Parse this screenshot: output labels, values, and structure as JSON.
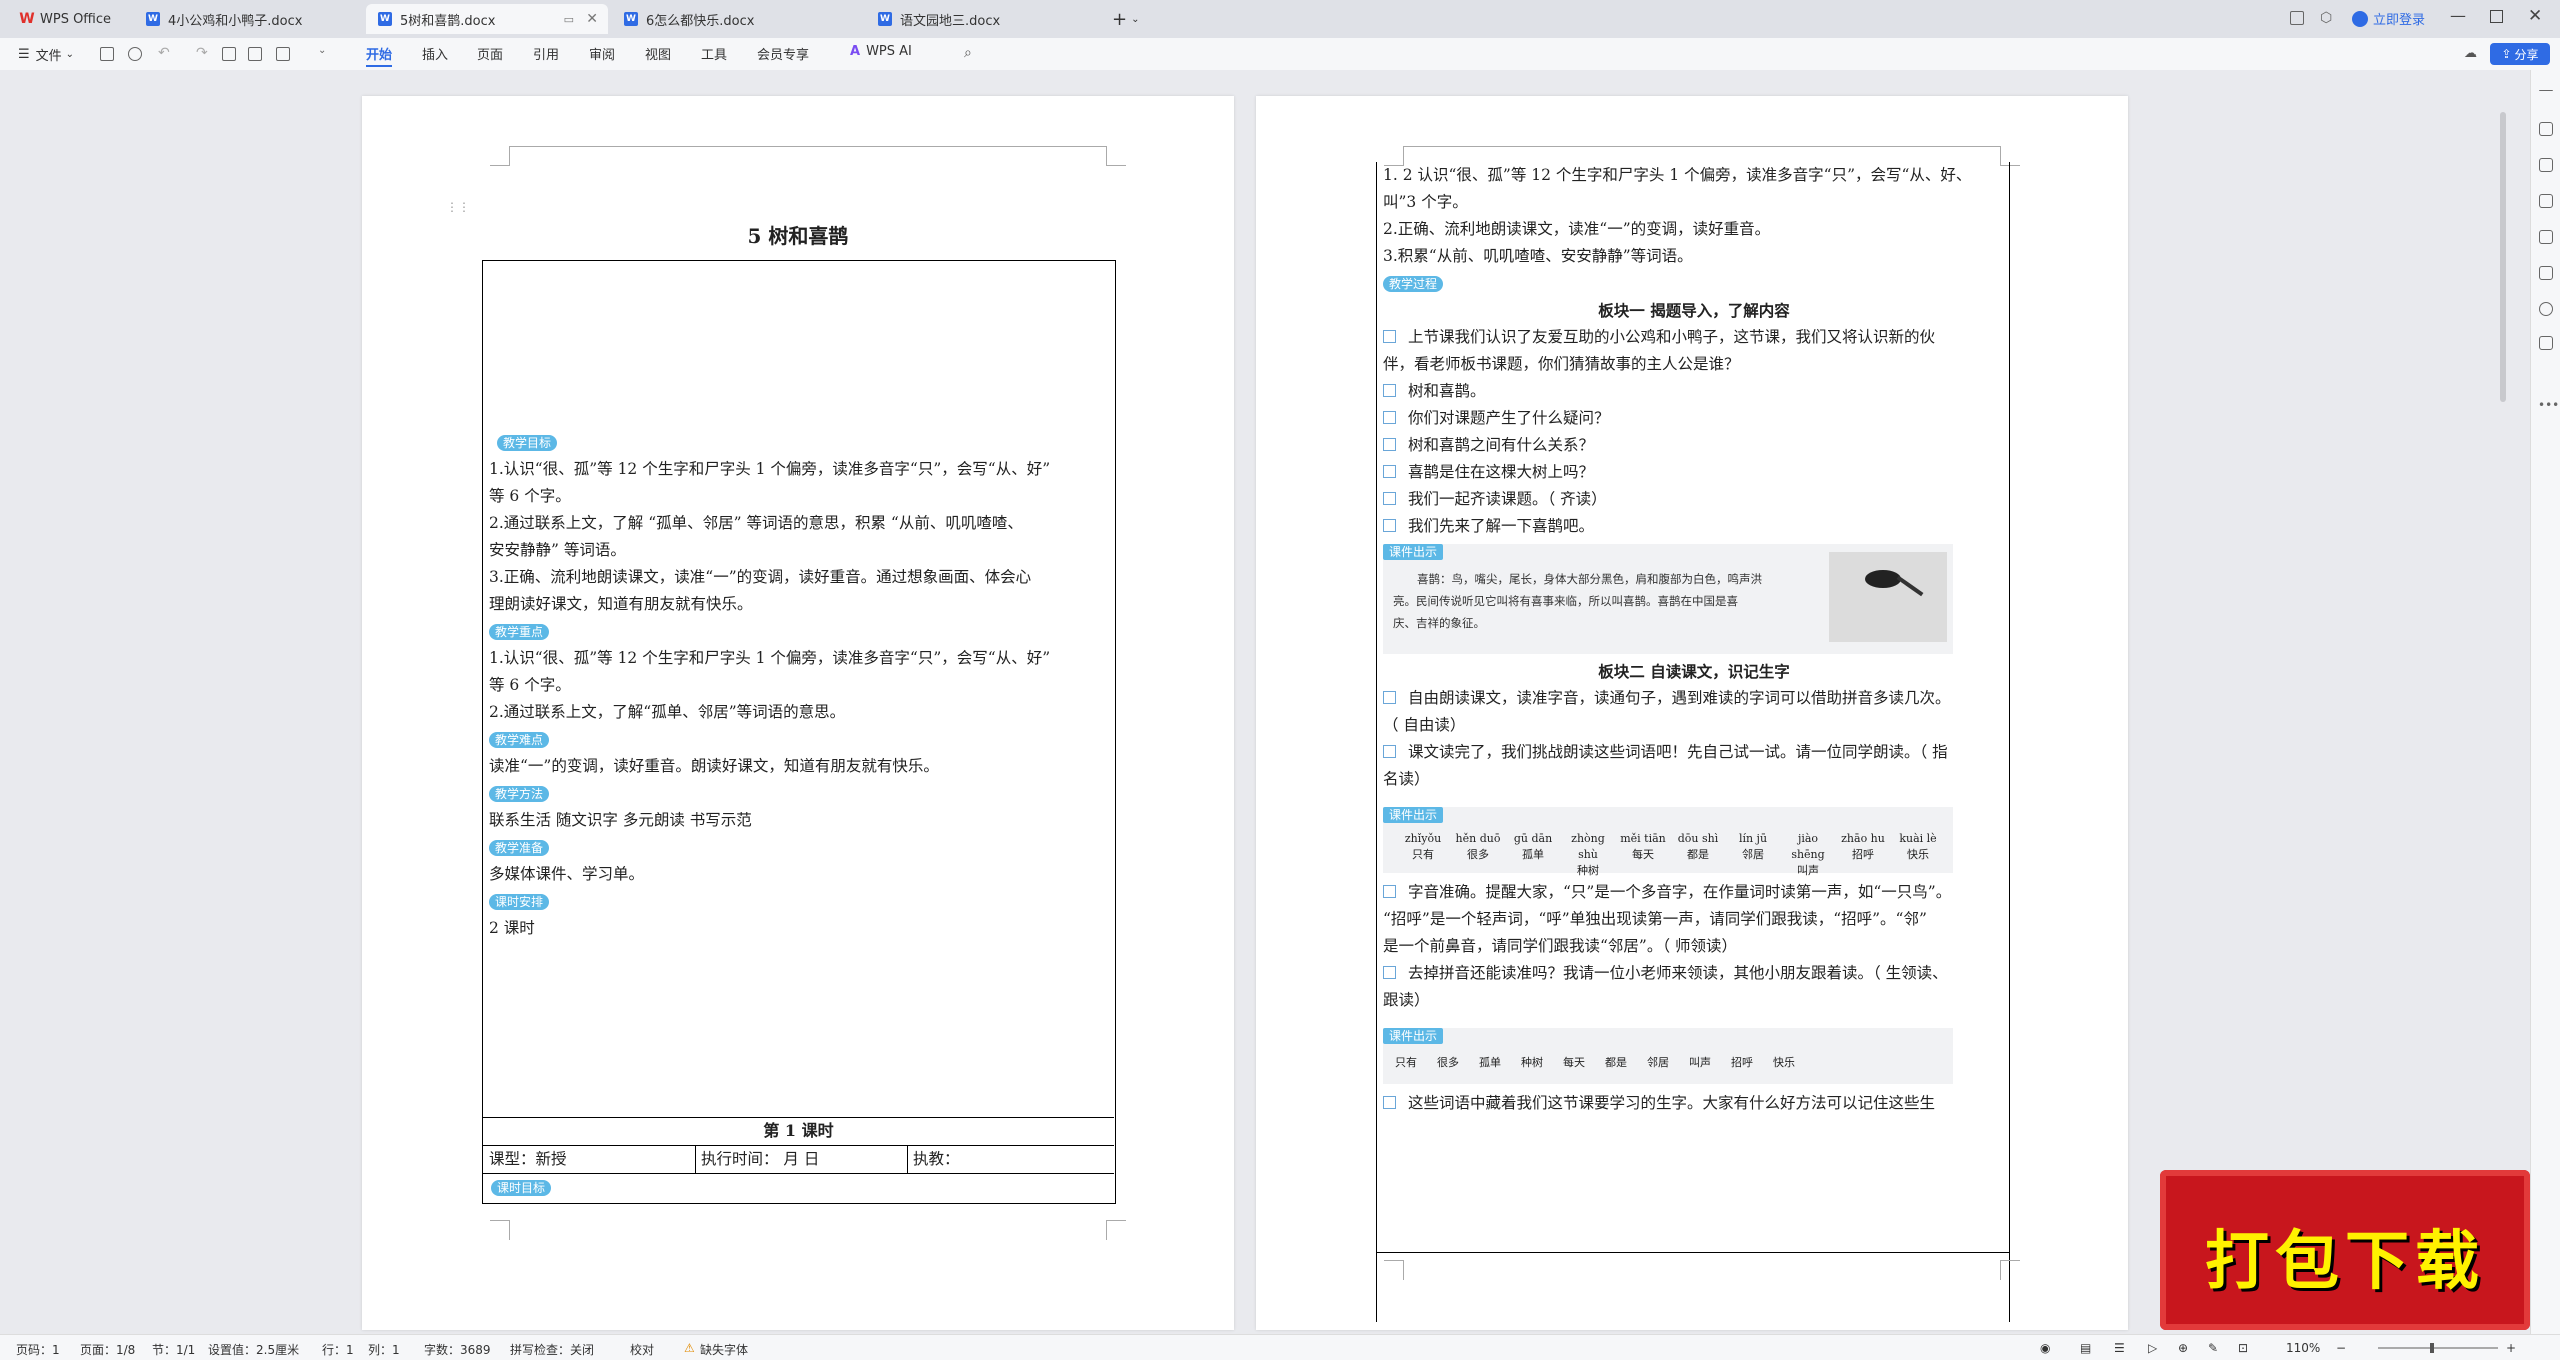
{
  "tabs": [
    {
      "label": "WPS Office",
      "icon": "wps-logo-icon"
    },
    {
      "label": "4小公鸡和小鸭子.docx",
      "icon": "word-doc-icon"
    },
    {
      "label": "5树和喜鹊.docx",
      "icon": "word-doc-icon",
      "active": true
    },
    {
      "label": "6怎么都快乐.docx",
      "icon": "word-doc-icon"
    },
    {
      "label": "语文园地三.docx",
      "icon": "word-doc-icon"
    }
  ],
  "topright": {
    "login": "立即登录",
    "share": "分享"
  },
  "toolbar": {
    "file": "文件",
    "menus": [
      "开始",
      "插入",
      "页面",
      "引用",
      "审阅",
      "视图",
      "工具",
      "会员专享"
    ],
    "ai": "WPS AI"
  },
  "page1": {
    "title": "5  树和喜鹊",
    "tags": [
      "教学目标",
      "教学重点",
      "教学难点",
      "教学方法",
      "教学准备",
      "课时安排"
    ],
    "goals": [
      "1.认识“很、孤”等 12 个生字和尸字头 1 个偏旁，读准多音字“只”，会写“从、好”",
      "等 6 个字。",
      "2.通过联系上文，了解 “孤单、邻居” 等词语的意思，积累 “从前、叽叽喳喳、",
      "安安静静” 等词语。",
      "3.正确、流利地朗读课文，读准“一”的变调，读好重音。通过想象画面、体会心",
      "理朗读好课文，知道有朋友就有快乐。"
    ],
    "key": [
      "1.认识“很、孤”等 12 个生字和尸字头 1 个偏旁，读准多音字“只”，会写“从、好”",
      "等 6 个字。",
      "2.通过联系上文，了解“孤单、邻居”等词语的意思。"
    ],
    "difficult": "读准“一”的变调，读好重音。朗读好课文，知道有朋友就有快乐。",
    "method": "联系生活  随文识字  多元朗读  书写示范",
    "prep": "多媒体课件、学习单。",
    "hours": "2 课时",
    "lesson": "第 1 课时",
    "type_label": "课型：新授",
    "time_label": "执行时间：        月      日",
    "teacher_label": "执教：",
    "bottom_tag": "课时目标"
  },
  "page2": {
    "lines_top": [
      "1. 2 认识“很、孤”等 12 个生字和尸字头 1 个偏旁，读准多音字“只”，会写“从、好、",
      "叫”3 个字。",
      "2.正确、流利地朗读课文，读准“一”的变调，读好重音。",
      "3.积累“从前、叽叽喳喳、安安静静”等词语。"
    ],
    "process_tag": "教学过程",
    "section1": "板块一  揭题导入，了解内容",
    "s1_lines": [
      "上节课我们认识了友爱互助的小公鸡和小鸭子，这节课，我们又将认识新的伙",
      "伴，看老师板书课题，你们猜猜故事的主人公是谁？"
    ],
    "s1_items": [
      "树和喜鹊。",
      "你们对课题产生了什么疑问？",
      "树和喜鹊之间有什么关系？",
      "喜鹊是住在这棵大树上吗？",
      "我们一起齐读课题。（ 齐读）",
      "我们先来了解一下喜鹊吧。"
    ],
    "callout_tag": "课件出示",
    "callout_text": [
      "喜鹊：鸟，嘴尖，尾长，身体大部分黑色，肩和腹部为白色，鸣声洪",
      "亮。民间传说听见它叫将有喜事来临，所以叫喜鹊。喜鹊在中国是喜",
      "庆、吉祥的象征。"
    ],
    "section2": "板块二  自读课文，识记生字",
    "s2_lines": [
      "自由朗读课文，读准字音，读通句子，遇到难读的字词可以借助拼音多读几次。",
      "（ 自由读）",
      "课文读完了，我们挑战朗读这些词语吧！先自己试一试。请一位同学朗读。（ 指",
      "名读）"
    ],
    "pinyin": [
      "zhǐyǒu",
      "hěn duō",
      "gū dān",
      "zhòng shù",
      "měi tiān",
      "dōu shì",
      "lín jū",
      "jiào shēng",
      "zhāo hu",
      "kuài lè"
    ],
    "hanzi": [
      "只有",
      "很多",
      "孤单",
      "种树",
      "每天",
      "都是",
      "邻居",
      "叫声",
      "招呼",
      "快乐"
    ],
    "s2_more": [
      "字音准确。提醒大家，“只”是一个多音字，在作量词时读第一声，如“一只鸟”。",
      "“招呼”是一个轻声词，“呼”单独出现读第一声，请同学们跟我读，“招呼”。“邻”",
      "是一个前鼻音，请同学们跟我读“邻居”。（ 师领读）",
      "去掉拼音还能读准吗？我请一位小老师来领读，其他小朋友跟着读。（ 生领读、",
      "跟读）"
    ],
    "words2": [
      "只有",
      "很多",
      "孤单",
      "种树",
      "每天",
      "都是",
      "邻居",
      "叫声",
      "招呼",
      "快乐"
    ],
    "last": "这些词语中藏着我们这节课要学习的生字。大家有什么好方法可以记住这些生"
  },
  "status": {
    "page": "页码：1",
    "pages": "页面：1/8",
    "section": "节：1/1",
    "setting": "设置值：2.5厘米",
    "row": "行：1",
    "col": "列：1",
    "words": "字数：3689",
    "spell": "拼写检查：关闭",
    "proof": "校对",
    "font": "缺失字体",
    "zoom": "110%"
  },
  "download": "打包下载",
  "colors": {
    "accent": "#2f6be4",
    "tag": "#5cb8e6",
    "banner": "#c8161d"
  }
}
